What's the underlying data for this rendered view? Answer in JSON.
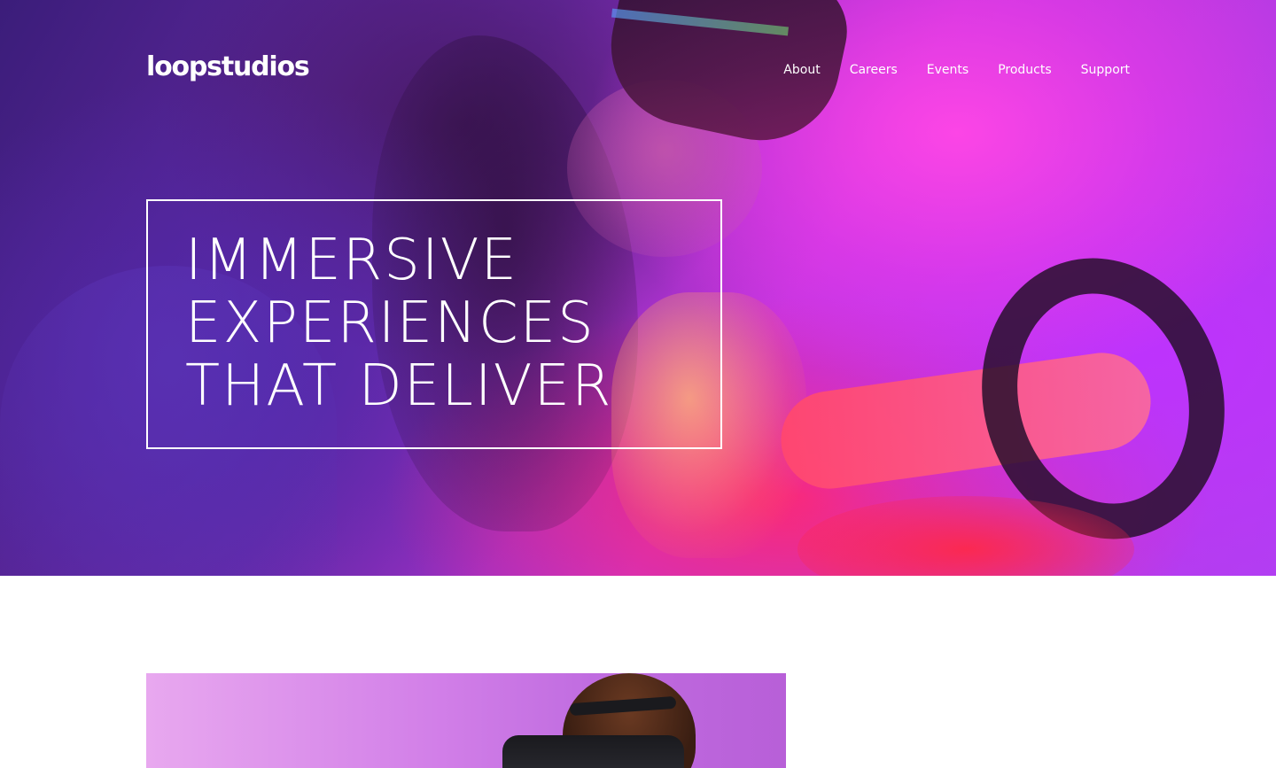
{
  "header": {
    "logo_text": "loopstudios",
    "nav": [
      {
        "label": "About"
      },
      {
        "label": "Careers"
      },
      {
        "label": "Events"
      },
      {
        "label": "Products"
      },
      {
        "label": "Support"
      }
    ]
  },
  "hero": {
    "headline_lines": [
      "IMMERSIVE",
      "EXPERIENCES",
      "THAT DELIVER"
    ]
  },
  "colors": {
    "text_on_hero": "#ffffff",
    "page_background": "#ffffff"
  }
}
